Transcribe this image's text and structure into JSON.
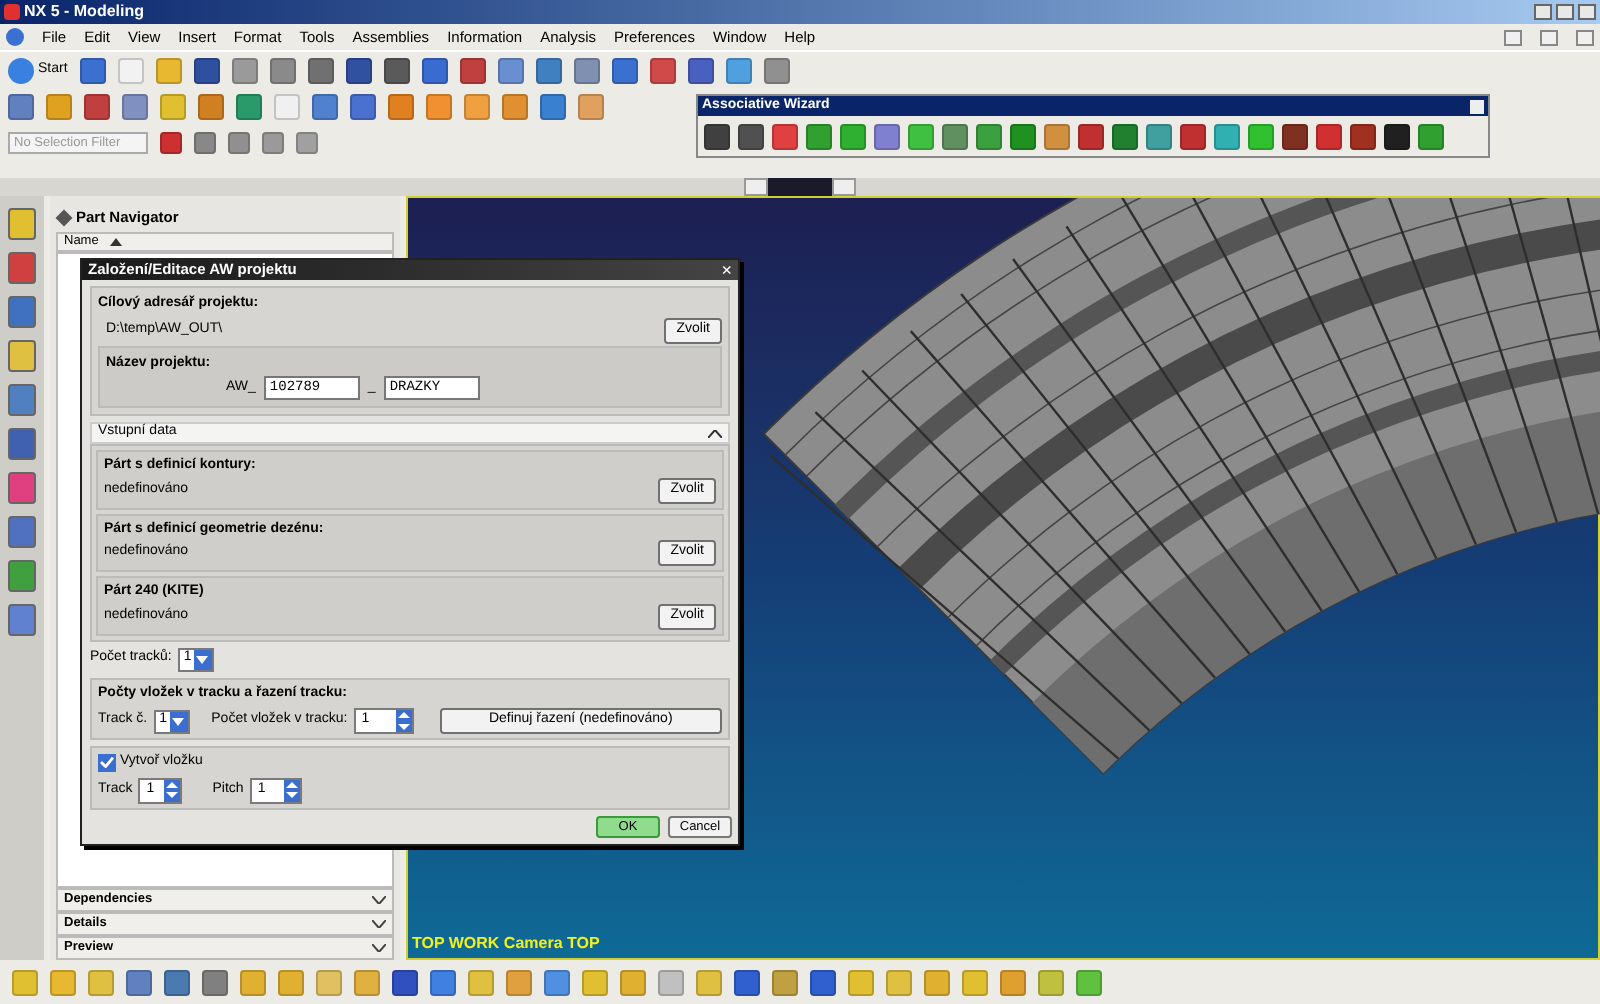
{
  "window": {
    "title": "NX 5 - Modeling"
  },
  "menu": [
    "File",
    "Edit",
    "View",
    "Insert",
    "Format",
    "Tools",
    "Assemblies",
    "Information",
    "Analysis",
    "Preferences",
    "Window",
    "Help"
  ],
  "toolbar": {
    "start_label": "Start"
  },
  "selection_filter": {
    "placeholder": "No Selection Filter"
  },
  "floating_toolbar": {
    "title": "Associative Wizard"
  },
  "navigator": {
    "title": "Part Navigator",
    "column": "Name",
    "panels": [
      "Dependencies",
      "Details",
      "Preview"
    ]
  },
  "viewport": {
    "label": "TOP WORK Camera TOP"
  },
  "dialog": {
    "title": "Založení/Editace AW projektu",
    "close": "×",
    "target": {
      "label": "Cílový adresář projektu:",
      "path": "D:\\temp\\AW_OUT\\",
      "button": "Zvolit"
    },
    "project": {
      "label": "Název projektu:",
      "prefix": "AW_",
      "number": "102789",
      "separator": "_",
      "name": "DRAZKY"
    },
    "input_section": {
      "title": "Vstupní data",
      "expanded": true,
      "parts": [
        {
          "label": "Párt s definicí kontury:",
          "value": "nedefinováno",
          "button": "Zvolit"
        },
        {
          "label": "Párt s definicí geometrie dezénu:",
          "value": "nedefinováno",
          "button": "Zvolit"
        },
        {
          "label": "Párt 240 (KITE)",
          "value": "nedefinováno",
          "button": "Zvolit"
        }
      ]
    },
    "track_count": {
      "label": "Počet tracků:",
      "value": "1"
    },
    "tracks": {
      "title": "Počty vložek v tracku a řazení tracku:",
      "track_label": "Track č.",
      "track_value": "1",
      "count_label": "Počet vložek v tracku:",
      "count_value": "1",
      "button": "Definuj řazení (nedefinováno)"
    },
    "insert": {
      "label": "Vytvoř vložku",
      "checked": true,
      "track_label": "Track",
      "track_value": "1",
      "pitch_label": "Pitch",
      "pitch_value": "1"
    },
    "buttons": [
      "OK",
      "Cancel"
    ]
  }
}
